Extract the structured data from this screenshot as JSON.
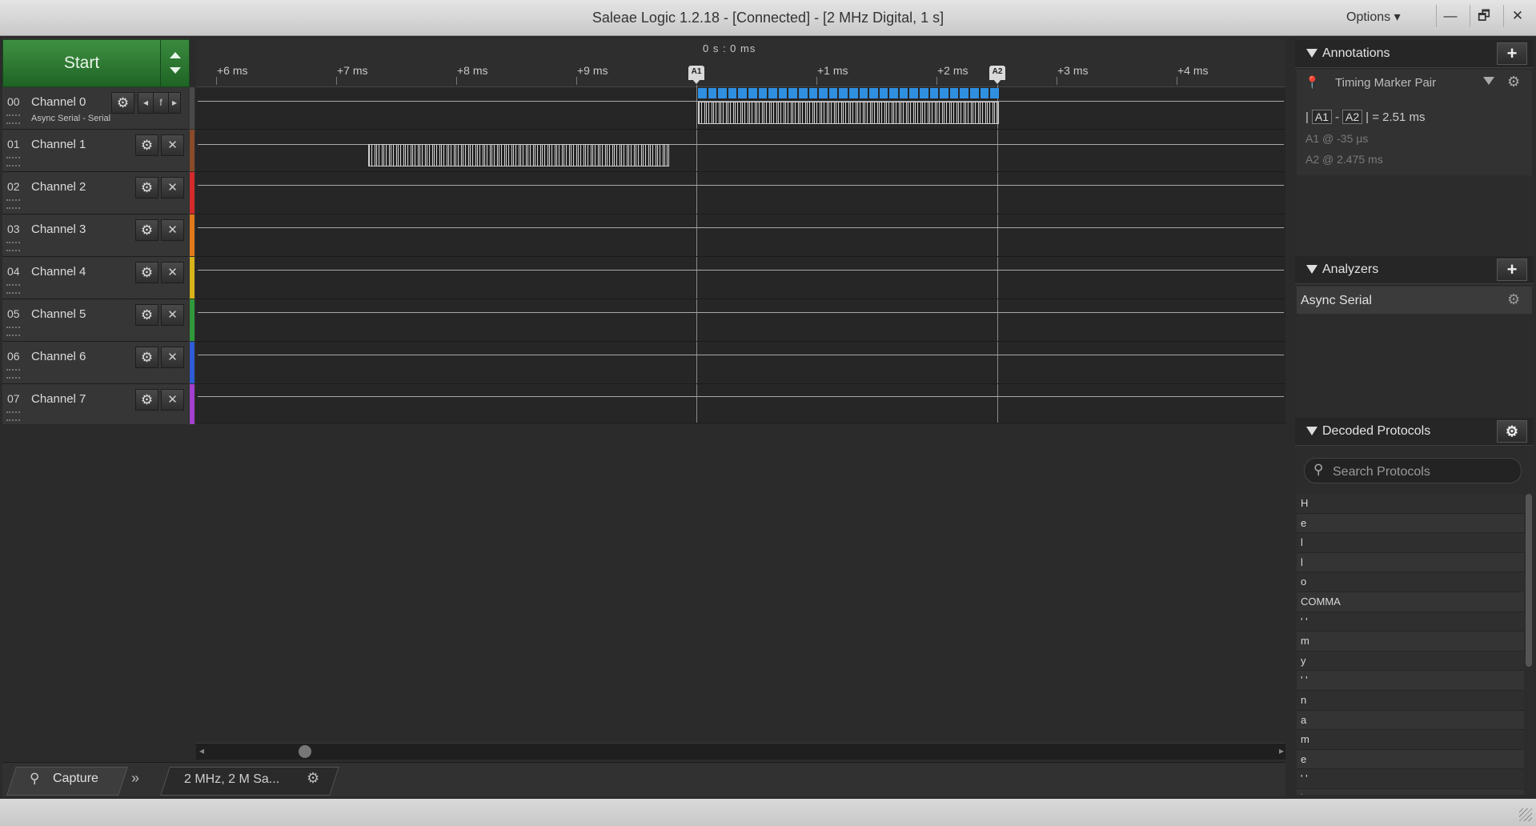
{
  "window": {
    "title": "Saleae Logic 1.2.18 - [Connected] - [2 MHz Digital, 1 s]",
    "options_label": "Options",
    "minimize": "—",
    "maximize": "🗗",
    "close": "✕"
  },
  "capture": {
    "start_label": "Start",
    "tab_label": "Capture",
    "rate_label": "2 MHz, 2 M Sa...",
    "expand_symbol": "»"
  },
  "timeline": {
    "center_time": "0 s : 0 ms",
    "ticks": [
      "+6 ms",
      "+7 ms",
      "+8 ms",
      "+9 ms",
      "+1 ms",
      "+2 ms",
      "+3 ms",
      "+4 ms"
    ],
    "marker_a1": "A1",
    "marker_a2": "A2"
  },
  "channels": [
    {
      "num": "00",
      "name": "Channel 0",
      "sub": "Async Serial - Serial",
      "color": "#4a4a4a"
    },
    {
      "num": "01",
      "name": "Channel 1",
      "sub": "",
      "color": "#8a4b2b"
    },
    {
      "num": "02",
      "name": "Channel 2",
      "sub": "",
      "color": "#d42a2a"
    },
    {
      "num": "03",
      "name": "Channel 3",
      "sub": "",
      "color": "#e07a1b"
    },
    {
      "num": "04",
      "name": "Channel 4",
      "sub": "",
      "color": "#d8b319"
    },
    {
      "num": "05",
      "name": "Channel 5",
      "sub": "",
      "color": "#2f9a3a"
    },
    {
      "num": "06",
      "name": "Channel 6",
      "sub": "",
      "color": "#2e5bd6"
    },
    {
      "num": "07",
      "name": "Channel 7",
      "sub": "",
      "color": "#a43fcf"
    }
  ],
  "annotations": {
    "header": "Annotations",
    "marker_pair": "Timing Marker Pair",
    "diff_a1": "A1",
    "diff_a2": "A2",
    "diff_value": "2.51 ms",
    "a1_line": "A1  @  -35 μs",
    "a2_line": "A2  @  2.475 ms"
  },
  "analyzers": {
    "header": "Analyzers",
    "items": [
      "Async Serial"
    ]
  },
  "decoded": {
    "header": "Decoded Protocols",
    "search_placeholder": "Search Protocols",
    "items": [
      "H",
      "e",
      "l",
      "l",
      "o",
      "COMMA",
      "' '",
      "m",
      "y",
      "' '",
      "n",
      "a",
      "m",
      "e",
      "' '",
      "i"
    ]
  },
  "icons": {
    "gear": "gear-icon",
    "close": "close-icon",
    "search": "search-icon",
    "plus": "plus-icon"
  }
}
